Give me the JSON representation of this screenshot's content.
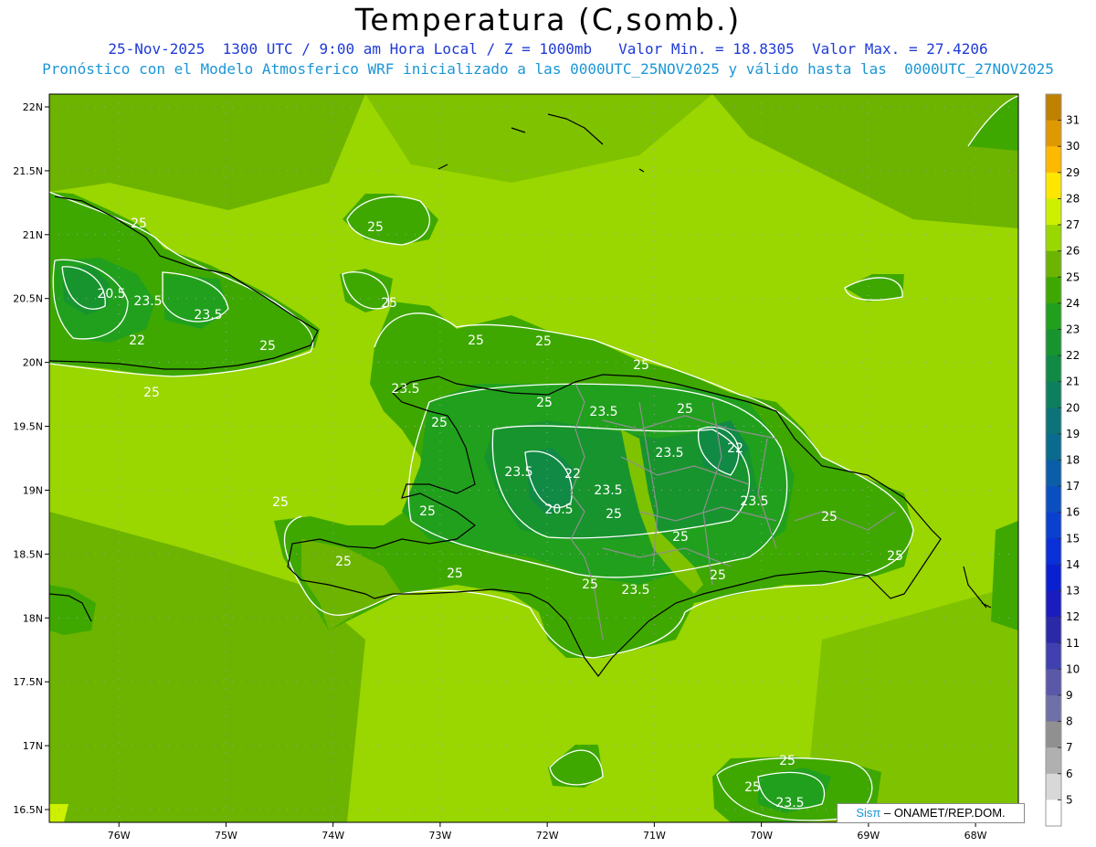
{
  "header": {
    "title": "Temperatura (C,somb.)",
    "subtitle_line1": "25-Nov-2025  1300 UTC / 9:00 am Hora Local / Z = 1000mb   Valor Min. = 18.8305  Valor Max. = 27.4206",
    "subtitle_line2": "Pronóstico con el Modelo Atmosferico WRF inicializado a las 0000UTC_25NOV2025 y válido hasta las  0000UTC_27NOV2025"
  },
  "axes": {
    "lat_labels": [
      "22N",
      "21.5N",
      "21N",
      "20.5N",
      "20N",
      "19.5N",
      "19N",
      "18.5N",
      "18N",
      "17.5N",
      "17N",
      "16.5N"
    ],
    "lat_values": [
      22,
      21.5,
      21,
      20.5,
      20,
      19.5,
      19,
      18.5,
      18,
      17.5,
      17,
      16.5
    ],
    "lon_labels": [
      "76W",
      "75W",
      "74W",
      "73W",
      "72W",
      "71W",
      "70W",
      "69W",
      "68W"
    ],
    "lon_values": [
      -76,
      -75,
      -74,
      -73,
      -72,
      -71,
      -70,
      -69,
      -68
    ],
    "lat_range": [
      16.4,
      22.1
    ],
    "lon_range": [
      -76.65,
      -67.6
    ]
  },
  "colorbar": {
    "labels": [
      "31",
      "30",
      "29",
      "28",
      "27",
      "26",
      "25",
      "24",
      "23",
      "22",
      "21",
      "20",
      "19",
      "18",
      "17",
      "16",
      "15",
      "14",
      "13",
      "12",
      "11",
      "10",
      "9",
      "8",
      "7",
      "6",
      "5"
    ],
    "colors": [
      "#c08000",
      "#e09800",
      "#ffb800",
      "#ffe600",
      "#cdf000",
      "#9ad600",
      "#6cb400",
      "#3ea800",
      "#21a01d",
      "#17942e",
      "#118a45",
      "#0e7f5e",
      "#0c7478",
      "#0a6a8f",
      "#0a5ea8",
      "#0a4fc0",
      "#0a40d0",
      "#0a30d8",
      "#0a20d0",
      "#1a1cc0",
      "#2a2aa8",
      "#4040b0",
      "#5a58a8",
      "#7070a8",
      "#909090",
      "#b0b0b0",
      "#d8d8d8",
      "#ffffff"
    ]
  },
  "contour_labels": [
    "25",
    "20.5",
    "23.5",
    "23.5",
    "22",
    "25",
    "25",
    "25",
    "25",
    "25",
    "25",
    "25",
    "23.5",
    "25",
    "23.5",
    "25",
    "22",
    "23.5",
    "23.5",
    "22",
    "23.5",
    "20.5",
    "23.5",
    "25",
    "25",
    "25",
    "25",
    "25",
    "25",
    "23.5",
    "25",
    "25",
    "25",
    "23.5"
  ],
  "credit": {
    "prefix": "Sisπ",
    "suffix": " – ONAMET/REP.DOM."
  },
  "colors": {
    "sea": "#9ad600",
    "land_low": "#6cb400",
    "land_mid": "#3ea800",
    "land_high": "#21a01d",
    "mountain": "#17942e",
    "contour": "#ffffff",
    "coast": "#000000",
    "border": "#909090"
  }
}
